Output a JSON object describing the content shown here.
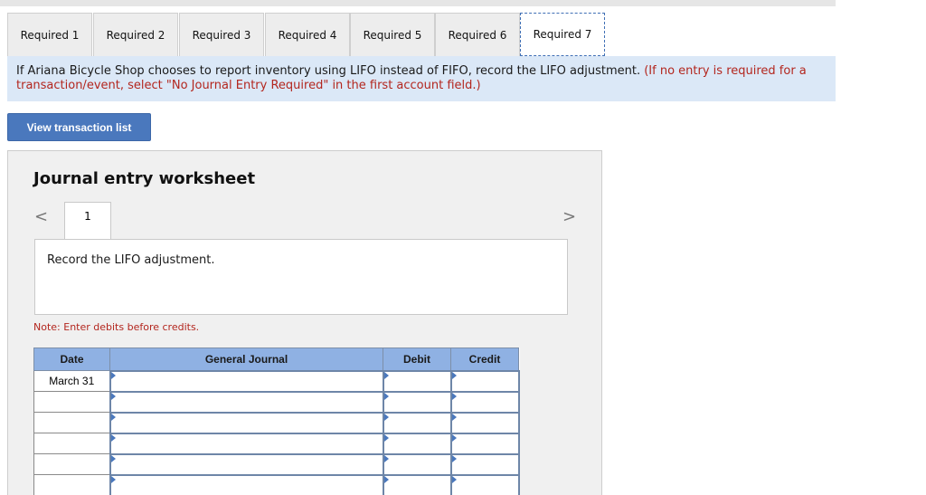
{
  "tabs": [
    {
      "label": "Required 1",
      "active": false
    },
    {
      "label": "Required 2",
      "active": false
    },
    {
      "label": "Required 3",
      "active": false
    },
    {
      "label": "Required 4",
      "active": false
    },
    {
      "label": "Required 5",
      "active": false
    },
    {
      "label": "Required 6",
      "active": false
    },
    {
      "label": "Required 7",
      "active": true
    }
  ],
  "instructions": {
    "main": "If Ariana Bicycle Shop chooses to report inventory using LIFO instead of FIFO, record the LIFO adjustment.",
    "note": "(If no entry is required for a transaction/event, select \"No Journal Entry Required\" in the first account field.)"
  },
  "view_button": "View transaction list",
  "worksheet": {
    "title": "Journal entry worksheet",
    "nav_prev": "<",
    "nav_next": ">",
    "entry_number": "1",
    "description": "Record the LIFO adjustment.",
    "note": "Note: Enter debits before credits."
  },
  "journal_table": {
    "headers": {
      "date": "Date",
      "account": "General Journal",
      "debit": "Debit",
      "credit": "Credit"
    },
    "rows": [
      {
        "date": "March 31",
        "account": "",
        "debit": "",
        "credit": ""
      },
      {
        "date": "",
        "account": "",
        "debit": "",
        "credit": ""
      },
      {
        "date": "",
        "account": "",
        "debit": "",
        "credit": ""
      },
      {
        "date": "",
        "account": "",
        "debit": "",
        "credit": ""
      },
      {
        "date": "",
        "account": "",
        "debit": "",
        "credit": ""
      },
      {
        "date": "",
        "account": "",
        "debit": "",
        "credit": ""
      }
    ]
  }
}
